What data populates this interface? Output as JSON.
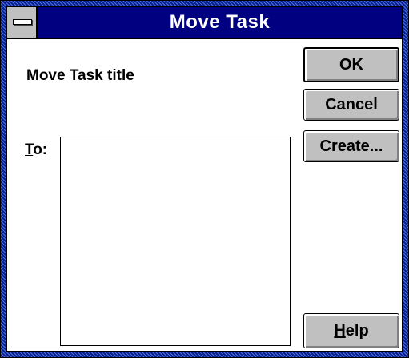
{
  "window": {
    "title": "Move Task"
  },
  "dialog": {
    "task_title": "Move Task title",
    "to_label_mnemonic": "T",
    "to_label_rest": "o:"
  },
  "buttons": {
    "ok": "OK",
    "cancel": "Cancel",
    "create": "Create...",
    "help_mnemonic": "H",
    "help_rest": "elp"
  },
  "icons": {
    "system_menu": "system-menu-icon"
  },
  "colors": {
    "titlebar": "#000080",
    "button_face": "#c0c0c0",
    "frame": "#0a1f8a"
  }
}
